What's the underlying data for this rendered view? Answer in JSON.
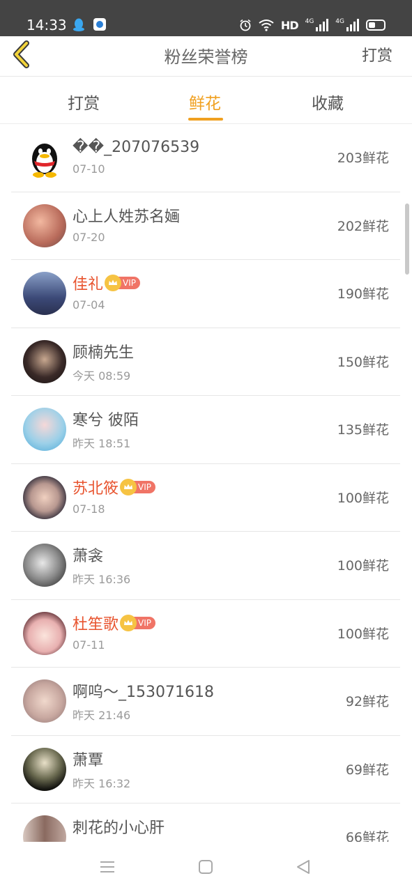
{
  "status_bar": {
    "time": "14:33",
    "hd_label": "HD",
    "network_label_1": "4G",
    "network_label_2": "4G",
    "icons": [
      "qq-icon",
      "app-icon",
      "alarm-icon",
      "wifi-icon",
      "hd-icon",
      "signal-icon",
      "signal-icon",
      "battery-icon"
    ]
  },
  "header": {
    "title": "粉丝荣誉榜",
    "action_label": "打赏",
    "back_icon": "chevron-left-icon"
  },
  "tabs": [
    {
      "label": "打赏",
      "active": false
    },
    {
      "label": "鲜花",
      "active": true
    },
    {
      "label": "收藏",
      "active": false
    }
  ],
  "colors": {
    "accent": "#f0a020",
    "vip_name": "#e8542f",
    "vip_badge": "#f07466",
    "crown": "#f6c343",
    "status_bar": "#444444"
  },
  "vip_label": "VIP",
  "fans": [
    {
      "name": "��_207076539",
      "date": "07-10",
      "count": "203鲜花",
      "vip": false
    },
    {
      "name": "心上人姓苏名婳",
      "date": "07-20",
      "count": "202鲜花",
      "vip": false
    },
    {
      "name": "佳礼",
      "date": "07-04",
      "count": "190鲜花",
      "vip": true
    },
    {
      "name": "顾楠先生",
      "date": "今天 08:59",
      "count": "150鲜花",
      "vip": false
    },
    {
      "name": "寒兮 彼陌",
      "date": "昨天 18:51",
      "count": "135鲜花",
      "vip": false
    },
    {
      "name": "苏北筱",
      "date": "07-18",
      "count": "100鲜花",
      "vip": true
    },
    {
      "name": "萧衾",
      "date": "昨天 16:36",
      "count": "100鲜花",
      "vip": false
    },
    {
      "name": "杜笙歌",
      "date": "07-11",
      "count": "100鲜花",
      "vip": true
    },
    {
      "name": "啊呜～_153071618",
      "date": "昨天 21:46",
      "count": "92鲜花",
      "vip": false
    },
    {
      "name": "萧覃",
      "date": "昨天 16:32",
      "count": "69鲜花",
      "vip": false
    },
    {
      "name": "刺花的小心肝",
      "date": "",
      "count": "66鲜花",
      "vip": false
    }
  ],
  "system_nav": [
    "menu-icon",
    "home-icon",
    "back-triangle-icon"
  ]
}
